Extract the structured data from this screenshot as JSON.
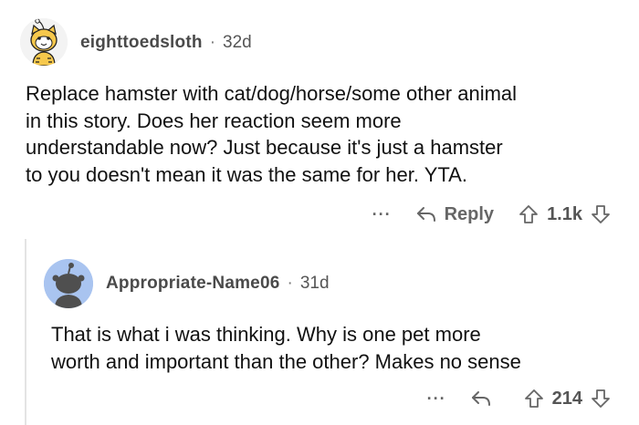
{
  "comments": [
    {
      "username": "eighttoedsloth",
      "separator": "·",
      "age": "32d",
      "avatar_icon": "snoo-avatar-cat-icon",
      "body_lines": [
        "Replace hamster with cat/dog/horse/some other animal",
        "in this story. Does her reaction seem more",
        "understandable now? Just because it's just a hamster",
        "to you doesn't mean it was the same for her. YTA."
      ],
      "more_label": "···",
      "reply_label": "Reply",
      "score": "1.1k"
    },
    {
      "username": "Appropriate-Name06",
      "separator": "·",
      "age": "31d",
      "avatar_icon": "default-snoo-avatar-icon",
      "body_lines": [
        "That is what i was thinking. Why is one pet more",
        "worth and important than the other? Makes no sense"
      ],
      "more_label": "···",
      "reply_label": "",
      "score": "214"
    }
  ],
  "colors": {
    "text": "#111111",
    "meta": "#444444",
    "icon": "#666666",
    "avatar2_bg": "#a9c4f0",
    "thread_line": "#e4e4e4"
  }
}
